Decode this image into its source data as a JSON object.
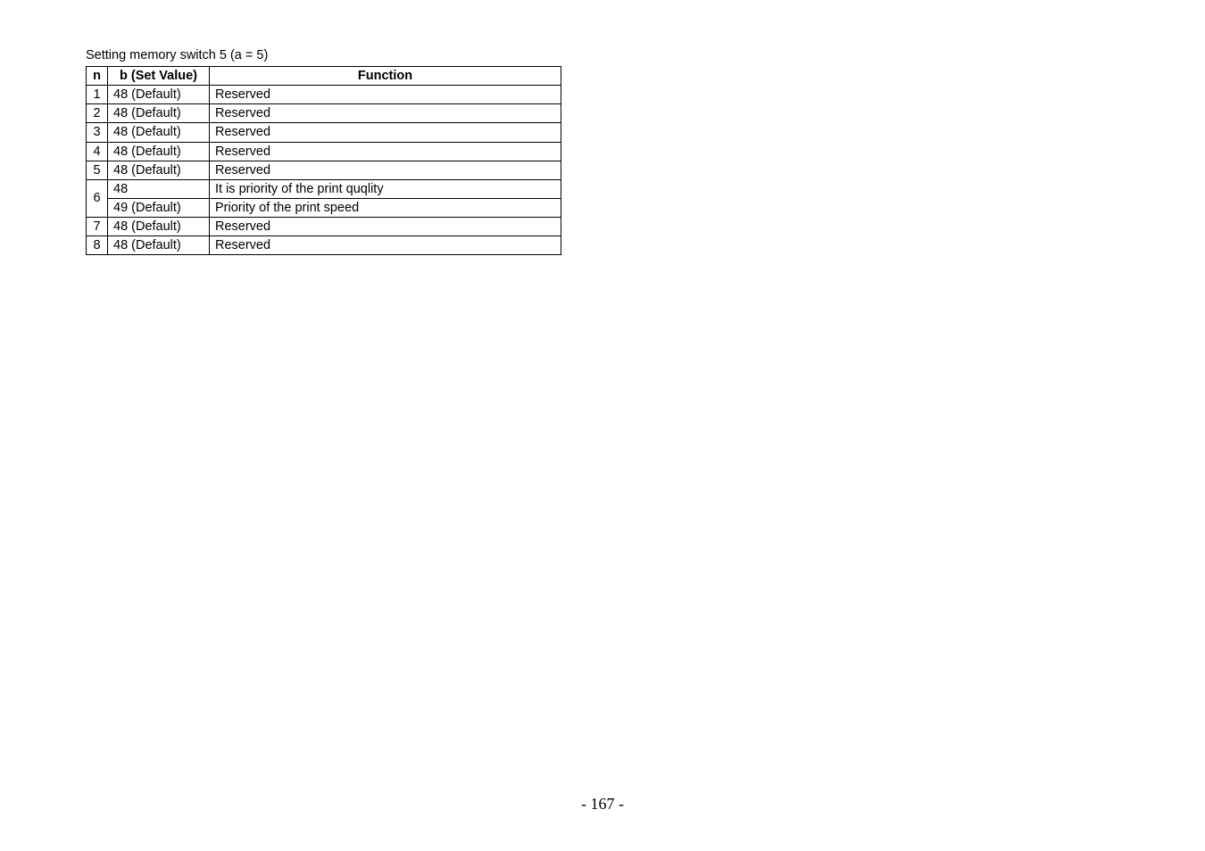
{
  "caption": "Setting memory switch 5 (a = 5)",
  "headers": {
    "n": "n",
    "b": "b (Set Value)",
    "func": "Function"
  },
  "rows": [
    {
      "n": "1",
      "b": "48 (Default)",
      "func": "Reserved"
    },
    {
      "n": "2",
      "b": "48 (Default)",
      "func": "Reserved"
    },
    {
      "n": "3",
      "b": "48 (Default)",
      "func": "Reserved"
    },
    {
      "n": "4",
      "b": "48 (Default)",
      "func": "Reserved"
    },
    {
      "n": "5",
      "b": "48 (Default)",
      "func": "Reserved"
    }
  ],
  "row6": {
    "n": "6",
    "sub": [
      {
        "b": "48",
        "func": "It is priority of the print quqlity"
      },
      {
        "b": "49 (Default)",
        "func": "Priority of the print speed"
      }
    ]
  },
  "tail": [
    {
      "n": "7",
      "b": "48 (Default)",
      "func": "Reserved"
    },
    {
      "n": "8",
      "b": "48 (Default)",
      "func": "Reserved"
    }
  ],
  "page_number": "- 167 -"
}
